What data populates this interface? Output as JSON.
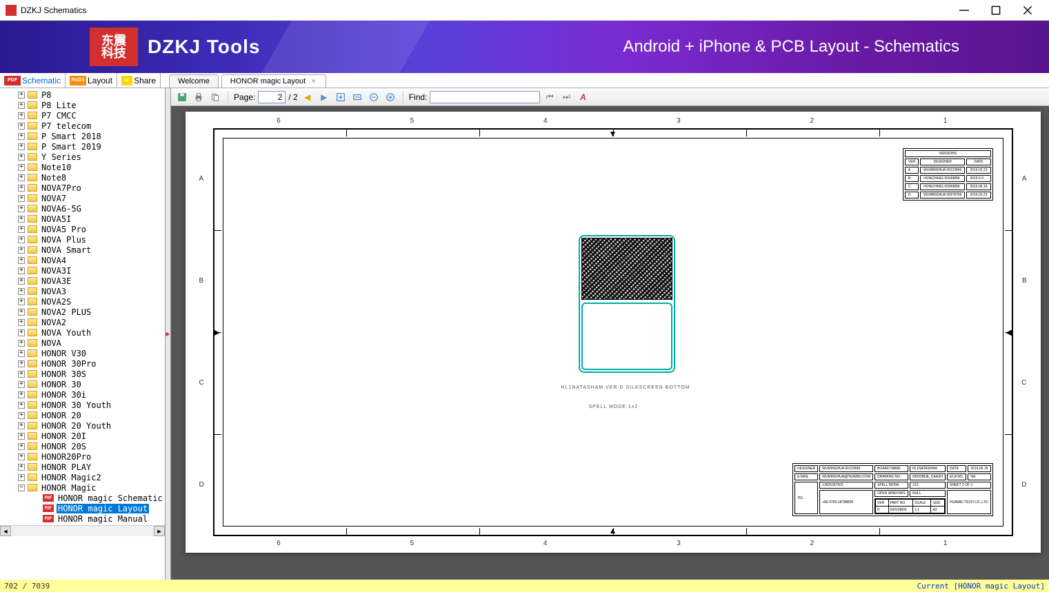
{
  "window": {
    "title": "DZKJ Schematics"
  },
  "banner": {
    "logo_cn1": "东震",
    "logo_cn2": "科技",
    "tools": "DZKJ Tools",
    "tagline": "Android + iPhone & PCB Layout - Schematics"
  },
  "app_tabs": {
    "schematic": "Schematic",
    "layout": "Layout",
    "share": "Share"
  },
  "doc_tabs": {
    "welcome": "Welcome",
    "active": "HONOR magic Layout"
  },
  "tree": {
    "items": [
      "P8",
      "P8 Lite",
      "P7 CMCC",
      "P7 telecom",
      "P Smart 2018",
      "P Smart 2019",
      "Y Series",
      "Note10",
      "Note8",
      "NOVA7Pro",
      "NOVA7",
      "NOVA6-5G",
      "NOVA5I",
      "NOVA5 Pro",
      "NOVA Plus",
      "NOVA Smart",
      "NOVA4",
      "NOVA3I",
      "NOVA3E",
      "NOVA3",
      "NOVA2S",
      "NOVA2 PLUS",
      "NOVA2",
      "NOVA Youth",
      "NOVA",
      "HONOR V30",
      "HONOR 30Pro",
      "HONOR 30S",
      "HONOR 30",
      "HONOR 30i",
      "HONOR 30 Youth",
      "HONOR 20",
      "HONOR 20 Youth",
      "HONOR 20I",
      "HONOR 20S",
      "HONOR20Pro",
      "HONOR PLAY",
      "HONOR Magic2"
    ],
    "expanded": "HONOR Magic",
    "children": [
      "HONOR magic Schematic",
      "HONOR magic Layout",
      "HONOR magic Manual"
    ],
    "selected": "HONOR magic Layout"
  },
  "toolbar": {
    "page_label": "Page:",
    "page_current": "2",
    "page_total": "/ 2",
    "find_label": "Find:"
  },
  "sheet": {
    "columns": [
      "6",
      "5",
      "4",
      "3",
      "2",
      "1"
    ],
    "rows": [
      "A",
      "B",
      "C",
      "D"
    ],
    "pcb_label": "HL1NATASHAM  VER.D SILKSCREEN BOTTOM",
    "spell_mode": "SPELL MODE:1x2",
    "versions_header": "VERSIONS",
    "versions_cols": [
      "VER",
      "DESIGNER",
      "DATE"
    ],
    "versions_rows": [
      [
        "A",
        "WUMINGHUA 00123845",
        "2016.03.23"
      ],
      [
        "B",
        "HONGYANG 00349858",
        "2016.5.9"
      ],
      [
        "C",
        "HONGYANG 00349858",
        "2015.06.18"
      ],
      [
        "D",
        "WUMINGHUA 00378769",
        "2016.03.23"
      ]
    ],
    "title_block": {
      "designer_l": "DESIGNER",
      "designer_v": "WUMINGHUA 00123845",
      "email_l": "E-MAIL",
      "email_v": "WUMINGHUA@HUAWEI.COM",
      "tel_l": "TEL",
      "tel_v1": "13826357663",
      "tel_v2": "+86-0755-28788806",
      "board_l": "BOARD NAME",
      "board_v": "HL1NATASHAM",
      "drawing_l": "DRAWING NO.",
      "drawing_v": "03022BDE_CAASH",
      "spell_l": "SPELL MODE",
      "spell_v": "1X2",
      "open_l": "OPEN WINDOWS",
      "open_v": "NULL",
      "ver_l": "VER",
      "part_l": "PART NO.",
      "scale_l": "SCALE",
      "size_l": "SIZE",
      "ver_v": "D",
      "part_v": "03022BDE",
      "scale_v": "1:1",
      "size_v": "A3",
      "date_l": "DATE",
      "date_v": "2016.06.18",
      "eca_l": "ECA NO.",
      "eca_v": "NA",
      "sheet_l": "SHEET 2 OF 2",
      "company": "HUAWEI TECH CO.,LTD"
    }
  },
  "status": {
    "left": "702 / 7039",
    "right": "Current [HONOR magic Layout]"
  }
}
